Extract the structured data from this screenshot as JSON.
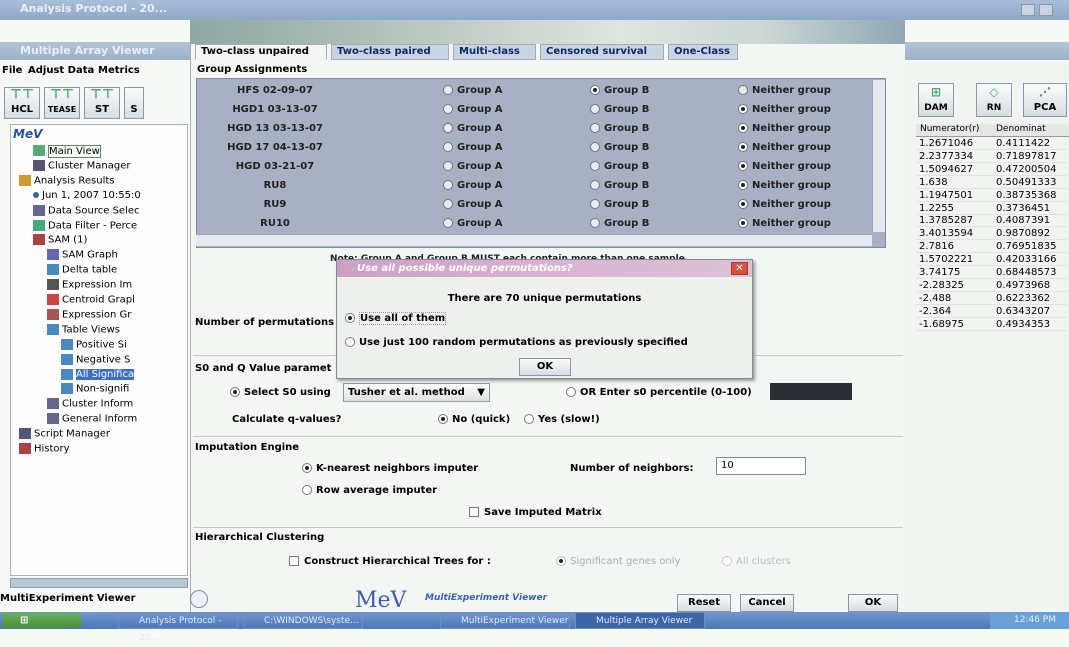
{
  "windows": {
    "outer_title": "Analysis Protocol - 20...",
    "mav_title": "Multiple Array Viewer"
  },
  "menu": [
    "File",
    "Adjust Data",
    "Metrics"
  ],
  "toolbar_left": [
    "HCL",
    "TEASE",
    "ST",
    "S"
  ],
  "toolbar_right": [
    "DAM",
    "RN",
    "PCA"
  ],
  "tree": {
    "logo": "MeV",
    "items": [
      {
        "label": "Main View",
        "indent": 1,
        "icon": "main-view-icon"
      },
      {
        "label": "Cluster Manager",
        "indent": 1,
        "icon": "cluster-manager-icon"
      },
      {
        "label": "Analysis Results",
        "indent": 0,
        "icon": "folder-icon"
      },
      {
        "label": "Jun 1, 2007 10:55:0",
        "indent": 1,
        "icon": "bullet-icon"
      },
      {
        "label": "Data Source Selec",
        "indent": 1,
        "icon": "data-source-icon"
      },
      {
        "label": "Data Filter - Perce",
        "indent": 1,
        "icon": "filter-icon"
      },
      {
        "label": "SAM (1)",
        "indent": 1,
        "icon": "sam-icon"
      },
      {
        "label": "SAM Graph",
        "indent": 2,
        "icon": "graph-icon"
      },
      {
        "label": "Delta table",
        "indent": 2,
        "icon": "table-icon"
      },
      {
        "label": "Expression Im",
        "indent": 2,
        "icon": "expression-image-icon"
      },
      {
        "label": "Centroid Grapl",
        "indent": 2,
        "icon": "centroid-graph-icon"
      },
      {
        "label": "Expression Gr",
        "indent": 2,
        "icon": "expression-graph-icon"
      },
      {
        "label": "Table Views",
        "indent": 2,
        "icon": "table-icon"
      },
      {
        "label": "Positive Si",
        "indent": 3,
        "icon": "table-icon"
      },
      {
        "label": "Negative S",
        "indent": 3,
        "icon": "table-icon"
      },
      {
        "label": "All Significa",
        "indent": 3,
        "icon": "table-icon",
        "selected": true
      },
      {
        "label": "Non-signifi",
        "indent": 3,
        "icon": "table-icon"
      },
      {
        "label": "Cluster Inform",
        "indent": 2,
        "icon": "cluster-info-icon"
      },
      {
        "label": "General Inform",
        "indent": 2,
        "icon": "info-icon"
      },
      {
        "label": "Script Manager",
        "indent": 0,
        "icon": "script-icon"
      },
      {
        "label": "History",
        "indent": 0,
        "icon": "history-icon"
      }
    ],
    "status": "MultiExperiment Viewer"
  },
  "tabs": [
    "Two-class unpaired",
    "Two-class paired",
    "Multi-class",
    "Censored survival",
    "One-Class"
  ],
  "group_assignments": {
    "title": "Group Assignments",
    "option_a": "Group A",
    "option_b": "Group B",
    "option_n": "Neither group",
    "rows": [
      {
        "name": "HFS 02-09-07",
        "selected": "b"
      },
      {
        "name": "HGD1 03-13-07",
        "selected": "n"
      },
      {
        "name": "HGD 13 03-13-07",
        "selected": "n"
      },
      {
        "name": "HGD 17 04-13-07",
        "selected": "n"
      },
      {
        "name": "HGD 03-21-07",
        "selected": "n"
      },
      {
        "name": "RU8",
        "selected": "n"
      },
      {
        "name": "RU9",
        "selected": "n"
      },
      {
        "name": "RU10",
        "selected": "n"
      }
    ],
    "note": "Note: Group A and Group B MUST each contain more than one sample."
  },
  "permutations_label": "Number of permutations",
  "dialog": {
    "title": "Use all possible unique permutations?",
    "message": "There are 70 unique permutations",
    "option1": "Use all of them",
    "option2": "Use just 100 random permutations as previously specified",
    "ok": "OK"
  },
  "s0": {
    "title": "S0 and Q Value paramet",
    "select_label": "Select S0 using",
    "select_value": "Tusher et al. method",
    "or_label": "OR Enter s0 percentile (0-100)",
    "q_label": "Calculate q-values?",
    "no_label": "No (quick)",
    "yes_label": "Yes (slow!)"
  },
  "imputation": {
    "title": "Imputation Engine",
    "knn_label": "K-nearest neighbors imputer",
    "neighbors_label": "Number of neighbors:",
    "neighbors_value": "10",
    "row_avg_label": "Row average imputer",
    "save_label": "Save Imputed Matrix"
  },
  "hierarchical": {
    "title": "Hierarchical Clustering",
    "construct_label": "Construct Hierarchical Trees for :",
    "significant_label": "Significant genes only",
    "all_label": "All clusters"
  },
  "footer": {
    "logo": "MeV",
    "logo_sub": "MultiExperiment Viewer",
    "reset": "Reset",
    "cancel": "Cancel",
    "ok": "OK"
  },
  "numbers": {
    "header_numerator": "Numerator(r)",
    "header_denominator": "Denominat",
    "rows": [
      [
        "1.2671046",
        "0.4111422"
      ],
      [
        "2.2377334",
        "0.71897817"
      ],
      [
        "1.5094627",
        "0.47200504"
      ],
      [
        "1.638",
        "0.50491333"
      ],
      [
        "1.1947501",
        "0.38735368"
      ],
      [
        "1.2255",
        "0.3736451"
      ],
      [
        "1.3785287",
        "0.4087391"
      ],
      [
        "3.4013594",
        "0.9870892"
      ],
      [
        "2.7816",
        "0.76951835"
      ],
      [
        "1.5702221",
        "0.42033166"
      ],
      [
        "3.74175",
        "0.68448573"
      ],
      [
        "-2.28325",
        "0.4973968"
      ],
      [
        "-2.488",
        "0.6223362"
      ],
      [
        "-2.364",
        "0.6343207"
      ],
      [
        "-1.68975",
        "0.4934353"
      ]
    ]
  },
  "taskbar": {
    "items": [
      "Analysis Protocol - 20...",
      "C:\\WINDOWS\\syste...",
      "MultiExperiment Viewer",
      "Multiple Array Viewer"
    ],
    "clock": "12:46 PM"
  },
  "colors": {
    "selected_group": "#9aa6ba",
    "titlebar": "#9eb2c9",
    "dialog_title": "#d7a7c8",
    "taskbar": "#4f7fbf"
  }
}
